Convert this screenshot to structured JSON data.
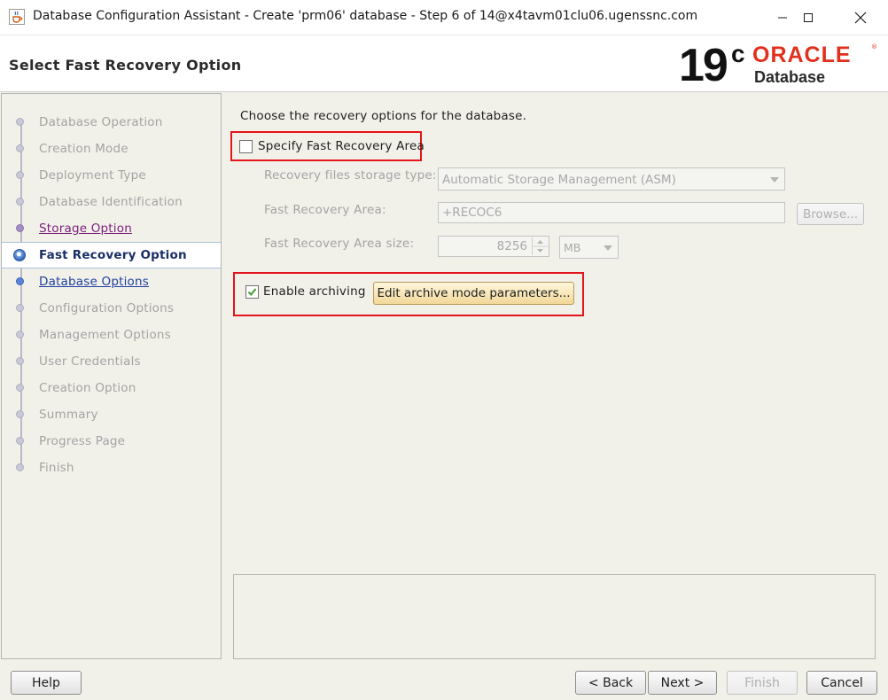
{
  "window": {
    "title": "Database Configuration Assistant - Create 'prm06' database - Step 6 of 14@x4tavm01clu06.ugenssnc.com",
    "app_icon": "java-coffee-icon"
  },
  "header": {
    "title": "Select Fast Recovery Option",
    "logo": {
      "version": "19",
      "version_suffix": "c",
      "brand": "ORACLE",
      "registered": "®",
      "product": "Database"
    }
  },
  "nav": {
    "items": [
      {
        "label": "Database Operation",
        "state": "disabled"
      },
      {
        "label": "Creation Mode",
        "state": "disabled"
      },
      {
        "label": "Deployment Type",
        "state": "disabled"
      },
      {
        "label": "Database Identification",
        "state": "disabled"
      },
      {
        "label": "Storage Option",
        "state": "visited"
      },
      {
        "label": "Fast Recovery Option",
        "state": "current"
      },
      {
        "label": "Database Options",
        "state": "link"
      },
      {
        "label": "Configuration Options",
        "state": "disabled"
      },
      {
        "label": "Management Options",
        "state": "disabled"
      },
      {
        "label": "User Credentials",
        "state": "disabled"
      },
      {
        "label": "Creation Option",
        "state": "disabled"
      },
      {
        "label": "Summary",
        "state": "disabled"
      },
      {
        "label": "Progress Page",
        "state": "disabled"
      },
      {
        "label": "Finish",
        "state": "disabled"
      }
    ]
  },
  "content": {
    "intro": "Choose the recovery options for the database.",
    "specify_fra": {
      "label": "Specify Fast Recovery Area",
      "checked": false
    },
    "storage_type": {
      "label": "Recovery files storage type:",
      "value": "Automatic Storage Management (ASM)"
    },
    "fra_location": {
      "label": "Fast Recovery Area:",
      "value": "+RECOC6",
      "browse_label": "Browse..."
    },
    "fra_size": {
      "label": "Fast Recovery Area size:",
      "value": "8256",
      "unit": "MB"
    },
    "archiving": {
      "label": "Enable archiving",
      "checked": true,
      "edit_button_label": "Edit archive mode parameters..."
    }
  },
  "footer": {
    "help_label": "Help",
    "back_label": "< Back",
    "next_label": "Next >",
    "finish_label": "Finish",
    "cancel_label": "Cancel"
  },
  "colors": {
    "highlight_box": "#e4151b",
    "oracle_red": "#e0301e",
    "panel_bg": "#f2f1e9",
    "current_step_text": "#1a2f66"
  }
}
